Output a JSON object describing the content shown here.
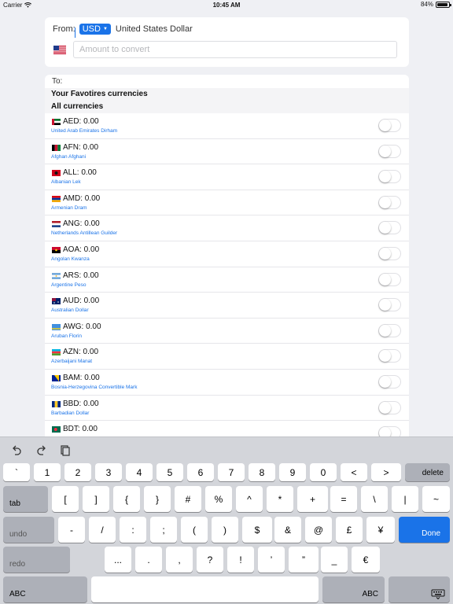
{
  "status_bar": {
    "carrier": "Carrier",
    "time": "10:45 AM",
    "battery": "84%"
  },
  "from": {
    "label": "From:",
    "currency_code": "USD",
    "currency_name": "United States Dollar",
    "amount_placeholder": "Amount to convert",
    "amount_value": ""
  },
  "to": {
    "label": "To:",
    "favorites_header": "Your Favotires currencies",
    "all_header": "All currencies"
  },
  "currencies": [
    {
      "code": "AED: 0.00",
      "name": "United Arab Emirates Dirham",
      "favorite": false
    },
    {
      "code": "AFN: 0.00",
      "name": "Afghan Afghani",
      "favorite": false
    },
    {
      "code": "ALL: 0.00",
      "name": "Albanian Lek",
      "favorite": false
    },
    {
      "code": "AMD: 0.00",
      "name": "Armenian Dram",
      "favorite": false
    },
    {
      "code": "ANG: 0.00",
      "name": "Netherlands Antillean Guilder",
      "favorite": false
    },
    {
      "code": "AOA: 0.00",
      "name": "Angolan Kwanza",
      "favorite": false
    },
    {
      "code": "ARS: 0.00",
      "name": "Argentine Peso",
      "favorite": false
    },
    {
      "code": "AUD: 0.00",
      "name": "Australian Dollar",
      "favorite": false
    },
    {
      "code": "AWG: 0.00",
      "name": "Aruban Florin",
      "favorite": false
    },
    {
      "code": "AZN: 0.00",
      "name": "Azerbaijani Manat",
      "favorite": false
    },
    {
      "code": "BAM: 0.00",
      "name": "Bosnia-Herzegovina Convertible Mark",
      "favorite": false
    },
    {
      "code": "BBD: 0.00",
      "name": "Barbadian Dollar",
      "favorite": false
    },
    {
      "code": "BDT: 0.00",
      "name": "",
      "favorite": false
    }
  ],
  "colors": {
    "accent": "#1a73e8",
    "background": "#eff0f4",
    "keyboard": "#d3d5da"
  },
  "keyboard": {
    "row1": [
      "`",
      "1",
      "2",
      "3",
      "4",
      "5",
      "6",
      "7",
      "8",
      "9",
      "0",
      "<",
      ">"
    ],
    "delete": "delete",
    "tab": "tab",
    "row2": [
      "[",
      "]",
      "{",
      "}",
      "#",
      "%",
      "^",
      "*",
      "+",
      "=",
      "\\",
      "|",
      "~"
    ],
    "undo": "undo",
    "row3": [
      "-",
      "/",
      ":",
      ";",
      "(",
      ")",
      "$",
      "&",
      "@",
      "£",
      "¥"
    ],
    "done": "Done",
    "redo": "redo",
    "row4": [
      "...",
      ".",
      ",",
      "?",
      "!",
      "’",
      "”",
      "_",
      "€"
    ],
    "abc_left": "ABC",
    "abc_right": "ABC"
  }
}
